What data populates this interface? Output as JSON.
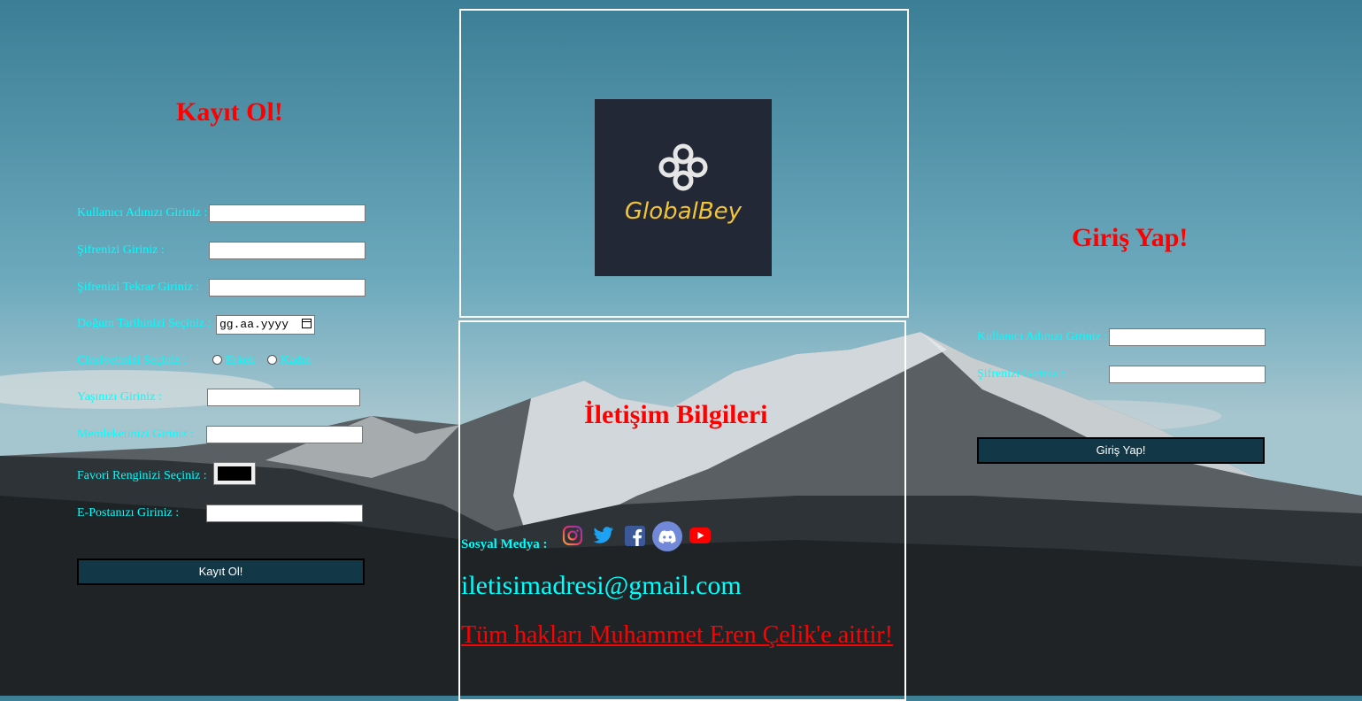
{
  "register": {
    "title": "Kayıt Ol!",
    "fields": [
      {
        "label": "Kullanıcı Adınızı Giriniz :",
        "value": ""
      },
      {
        "label": "Şifrenizi Giriniz :",
        "value": ""
      },
      {
        "label": "Şifrenizi Tekrar Giriniz :",
        "value": ""
      },
      {
        "label": "Doğum Tarihinizi Seçiniz :",
        "value": "gg.aa.yyyy"
      },
      {
        "label": "Cinsiyetinizi Seçiniz :",
        "value": ""
      },
      {
        "label": "Yaşınızı Giriniz :",
        "value": ""
      },
      {
        "label": "Memleketinizi Giriniz :",
        "value": ""
      },
      {
        "label": "Favori Renginizi Seçiniz :",
        "value": "#000000"
      },
      {
        "label": "E-Postanızı Giriniz :",
        "value": ""
      }
    ],
    "gender_options": [
      "Erkek",
      "Kadın"
    ],
    "submit_label": "Kayıt Ol!"
  },
  "logo": {
    "text": "GlobalBey",
    "bg_color": "#232837",
    "text_color": "#f2c438"
  },
  "contact": {
    "title": "İletişim Bilgileri",
    "social_label": "Sosyal Medya :",
    "social_icons": [
      "instagram-icon",
      "twitter-icon",
      "facebook-icon",
      "discord-icon",
      "youtube-icon"
    ],
    "email": "iletisimadresi@gmail.com",
    "rights": "Tüm hakları Muhammet Eren Çelik'e aittir!"
  },
  "login": {
    "title": "Giriş Yap!",
    "fields": [
      {
        "label": "Kullanıcı Adınızı Giriniz :",
        "value": ""
      },
      {
        "label": "Şifrenizi Giriniz :",
        "value": ""
      }
    ],
    "submit_label": "Giriş Yap!"
  },
  "colors": {
    "heading": "#ff0000",
    "label": "#00ffff",
    "button_bg": "#123746"
  }
}
